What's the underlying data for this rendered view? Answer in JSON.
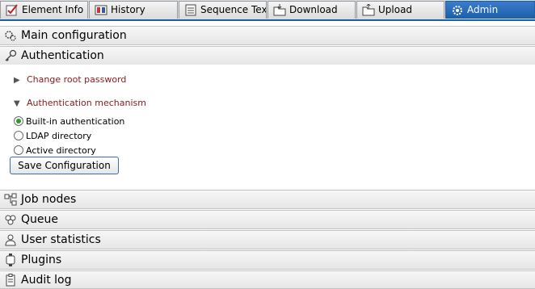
{
  "tabs": [
    {
      "label": "Element Info",
      "icon": "element-info-icon"
    },
    {
      "label": "History",
      "icon": "history-icon"
    },
    {
      "label": "Sequence Text",
      "icon": "document-icon"
    },
    {
      "label": "Download",
      "icon": "folder-download-icon"
    },
    {
      "label": "Upload",
      "icon": "folder-upload-icon"
    },
    {
      "label": "Admin",
      "icon": "admin-gear-icon",
      "active": true
    }
  ],
  "sections": {
    "main_configuration": "Main configuration",
    "authentication": "Authentication",
    "job_nodes": "Job nodes",
    "queue": "Queue",
    "user_statistics": "User statistics",
    "plugins": "Plugins",
    "audit_log": "Audit log"
  },
  "auth": {
    "change_root_password": "Change root password",
    "mechanism_label": "Authentication mechanism",
    "options": [
      {
        "label": "Built-in authentication",
        "selected": true
      },
      {
        "label": "LDAP directory",
        "selected": false
      },
      {
        "label": "Active directory",
        "selected": false
      }
    ],
    "save_label": "Save Configuration"
  },
  "colors": {
    "accent": "#1c5fa8",
    "link_text": "#8b1a1a",
    "radio_selected": "#2d9a2d"
  }
}
